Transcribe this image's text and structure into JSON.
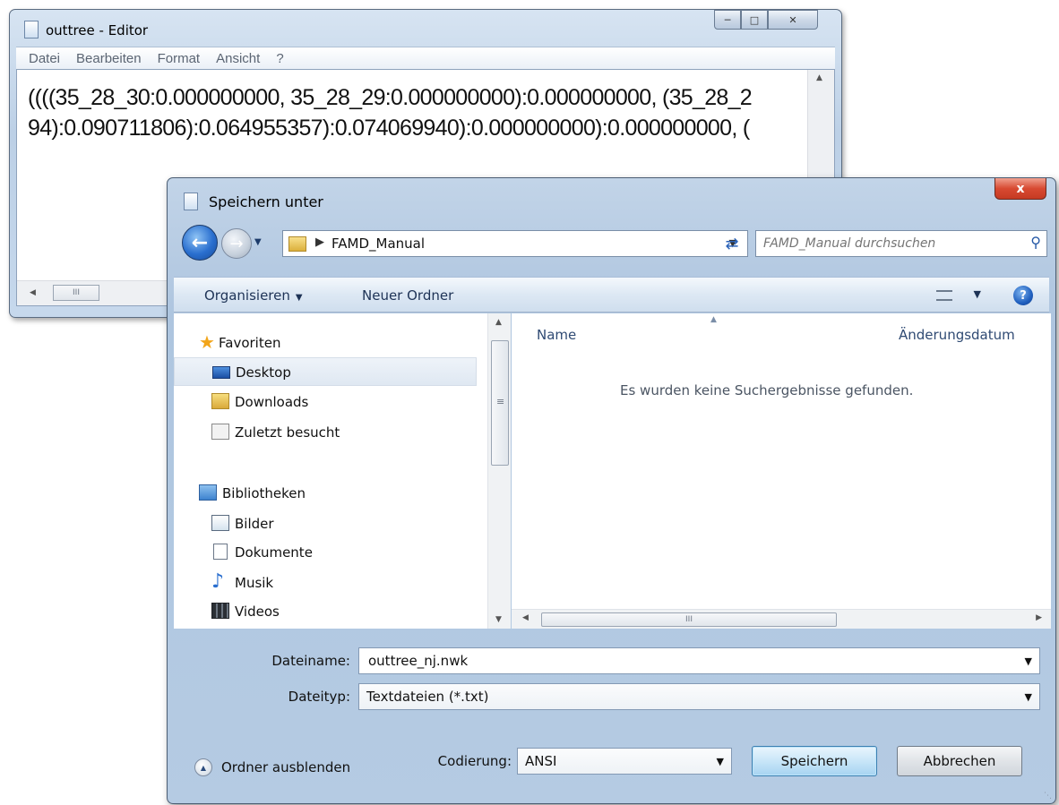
{
  "editor": {
    "title": "outtree - Editor",
    "menu": [
      "Datei",
      "Bearbeiten",
      "Format",
      "Ansicht",
      "?"
    ],
    "text_lines": [
      "((((35_28_30:0.000000000, 35_28_29:0.000000000):0.000000000, (35_28_2",
      "94):0.090711806):0.064955357):0.074069940):0.000000000):0.000000000, ("
    ],
    "hscroll_grip": "III"
  },
  "dialog": {
    "title": "Speichern unter",
    "close_label": "x",
    "address": {
      "path": "FAMD_Manual"
    },
    "search": {
      "placeholder": "FAMD_Manual durchsuchen"
    },
    "toolbar": {
      "organize": "Organisieren",
      "new_folder": "Neuer Ordner"
    },
    "nav": {
      "items": [
        {
          "label": "Favoriten",
          "icon": "star-icon"
        },
        {
          "label": "Desktop",
          "icon": "desktop-icon"
        },
        {
          "label": "Downloads",
          "icon": "downloads-folder-icon"
        },
        {
          "label": "Zuletzt besucht",
          "icon": "recent-places-icon"
        },
        {
          "label": "Bibliotheken",
          "icon": "libraries-icon"
        },
        {
          "label": "Bilder",
          "icon": "pictures-icon"
        },
        {
          "label": "Dokumente",
          "icon": "documents-icon"
        },
        {
          "label": "Musik",
          "icon": "music-icon"
        },
        {
          "label": "Videos",
          "icon": "videos-icon"
        }
      ],
      "selected": "Desktop"
    },
    "files": {
      "columns": [
        "Name",
        "Änderungsdatum"
      ],
      "empty_message": "Es wurden keine Suchergebnisse gefunden."
    },
    "scroll_grip_v": "≡",
    "scroll_grip_h": "III",
    "filename": {
      "label": "Dateiname:",
      "value": "outtree_nj.nwk"
    },
    "filetype": {
      "label": "Dateityp:",
      "value": "Textdateien (*.txt)"
    },
    "hide_folders": "Ordner ausblenden",
    "encoding": {
      "label": "Codierung:",
      "value": "ANSI"
    },
    "buttons": {
      "save": "Speichern",
      "cancel": "Abbrechen"
    }
  }
}
